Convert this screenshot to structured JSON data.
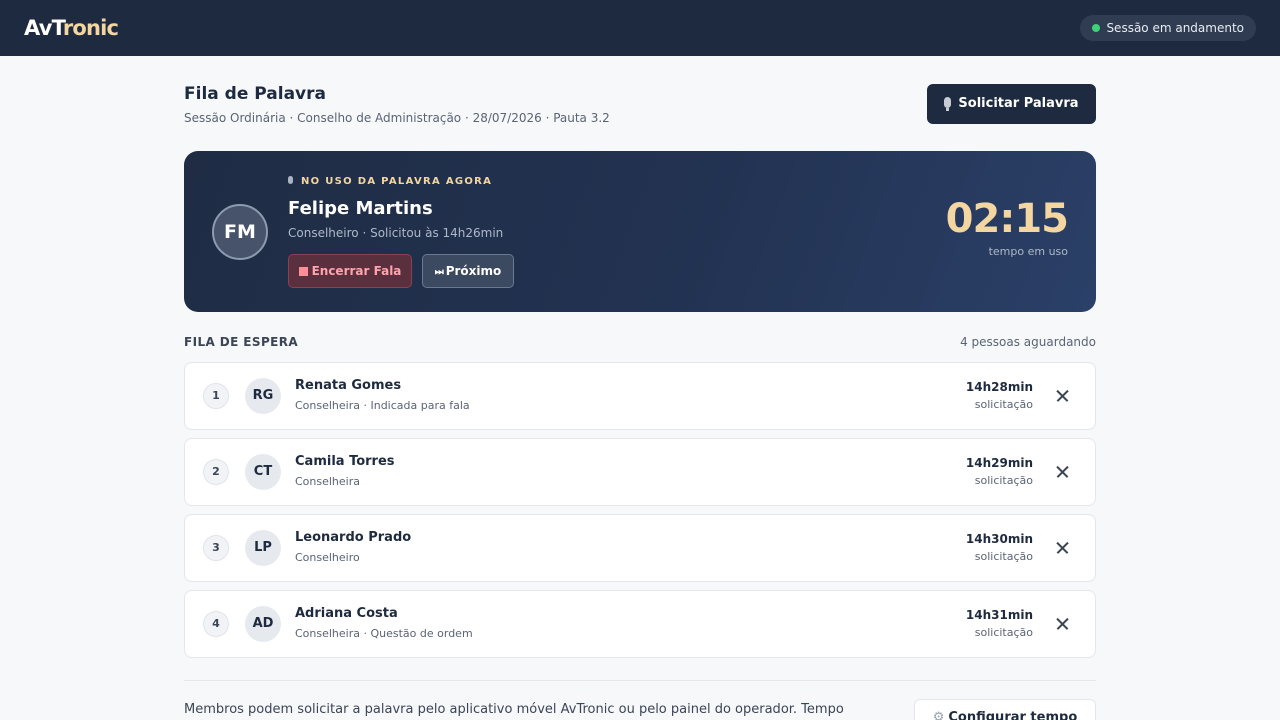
{
  "app": {
    "logo_main": "AvT",
    "logo_accent": "ronic",
    "session_status": "Sessão em andamento"
  },
  "header": {
    "title": "Fila de Palavra",
    "subtitle": "Sessão Ordinária · Conselho de Administração · 28/07/2026 · Pauta 3.2",
    "request_button": "Solicitar Palavra"
  },
  "current_speaker": {
    "label": "NO USO DA PALAVRA AGORA",
    "initials": "FM",
    "name": "Felipe Martins",
    "meta": "Conselheiro · Solicitou às 14h26min",
    "end_button": "Encerrar Fala",
    "next_button": "Próximo",
    "timer": "02:15",
    "timer_label": "tempo em uso"
  },
  "queue": {
    "heading": "FILA DE ESPERA",
    "count_text": "4 pessoas aguardando",
    "items": [
      {
        "position": "1",
        "initials": "RG",
        "name": "Renata Gomes",
        "role": "Conselheira · Indicada para fala",
        "time": "14h28min",
        "time_label": "solicitação"
      },
      {
        "position": "2",
        "initials": "CT",
        "name": "Camila Torres",
        "role": "Conselheira",
        "time": "14h29min",
        "time_label": "solicitação"
      },
      {
        "position": "3",
        "initials": "LP",
        "name": "Leonardo Prado",
        "role": "Conselheiro",
        "time": "14h30min",
        "time_label": "solicitação"
      },
      {
        "position": "4",
        "initials": "AD",
        "name": "Adriana Costa",
        "role": "Conselheira · Questão de ordem",
        "time": "14h31min",
        "time_label": "solicitação"
      }
    ]
  },
  "footer": {
    "note": "Membros podem solicitar a palavra pelo aplicativo móvel AvTronic ou pelo painel do operador. Tempo",
    "config_button": "Configurar tempo"
  },
  "colors": {
    "navy": "#1e2a3f",
    "accent_gold": "#f3d6a0",
    "status_green": "#3ed17a",
    "danger": "#ff8e99"
  },
  "icons": [
    "microphone-icon",
    "stop-icon",
    "skip-forward-icon",
    "close-icon",
    "gear-icon",
    "status-dot-icon"
  ]
}
